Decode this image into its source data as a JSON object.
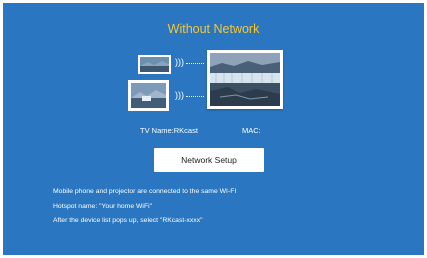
{
  "screen": {
    "title": "Without Network",
    "tv_name_label": "TV Name:RKcast",
    "mac_label": "MAC:",
    "network_setup_button": "Network Setup",
    "instructions": [
      "Mobile phone and projector are connected to the same WI-FI",
      "Hotspot name: \"Your home WiFi\"",
      "After the device list pops up, select \"RKcast-xxxx\""
    ]
  },
  "colors": {
    "background": "#2a76c0",
    "title": "#f4c73a",
    "text": "#ffffff",
    "button_bg": "#ffffff"
  },
  "icons": [
    "phone-icon",
    "tablet-icon",
    "wifi-signal-icon",
    "tv-icon"
  ]
}
